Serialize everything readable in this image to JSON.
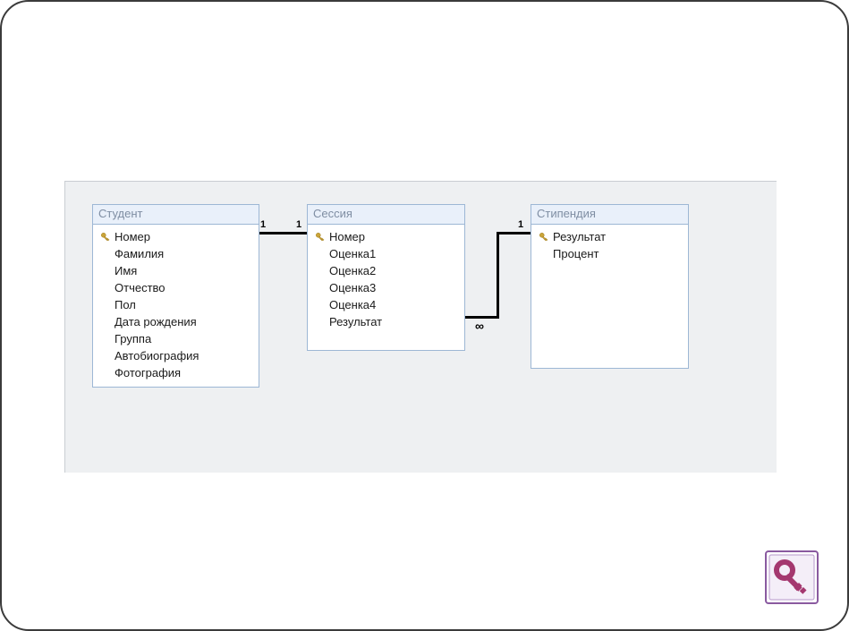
{
  "tables": {
    "student": {
      "title": "Студент",
      "fields": [
        {
          "name": "Номер",
          "pk": true
        },
        {
          "name": "Фамилия",
          "pk": false
        },
        {
          "name": "Имя",
          "pk": false
        },
        {
          "name": "Отчество",
          "pk": false
        },
        {
          "name": "Пол",
          "pk": false
        },
        {
          "name": "Дата рождения",
          "pk": false
        },
        {
          "name": "Группа",
          "pk": false
        },
        {
          "name": "Автобиография",
          "pk": false
        },
        {
          "name": "Фотография",
          "pk": false
        }
      ]
    },
    "session": {
      "title": "Сессия",
      "fields": [
        {
          "name": "Номер",
          "pk": true
        },
        {
          "name": "Оценка1",
          "pk": false
        },
        {
          "name": "Оценка2",
          "pk": false
        },
        {
          "name": "Оценка3",
          "pk": false
        },
        {
          "name": "Оценка4",
          "pk": false
        },
        {
          "name": "Результат",
          "pk": false
        }
      ]
    },
    "stipend": {
      "title": "Стипендия",
      "fields": [
        {
          "name": "Результат",
          "pk": true
        },
        {
          "name": "Процент",
          "pk": false
        }
      ]
    }
  },
  "relationships": [
    {
      "from": "student",
      "to": "session",
      "from_card": "1",
      "to_card": "1"
    },
    {
      "from": "session",
      "to": "stipend",
      "from_card": "∞",
      "to_card": "1"
    }
  ],
  "colors": {
    "canvas_bg": "#eef0f2",
    "box_border": "#9db7d5",
    "title_bg": "#e9f0fa",
    "title_fg": "#7f8ea3",
    "line": "#000000",
    "access_magenta": "#a4386f"
  }
}
